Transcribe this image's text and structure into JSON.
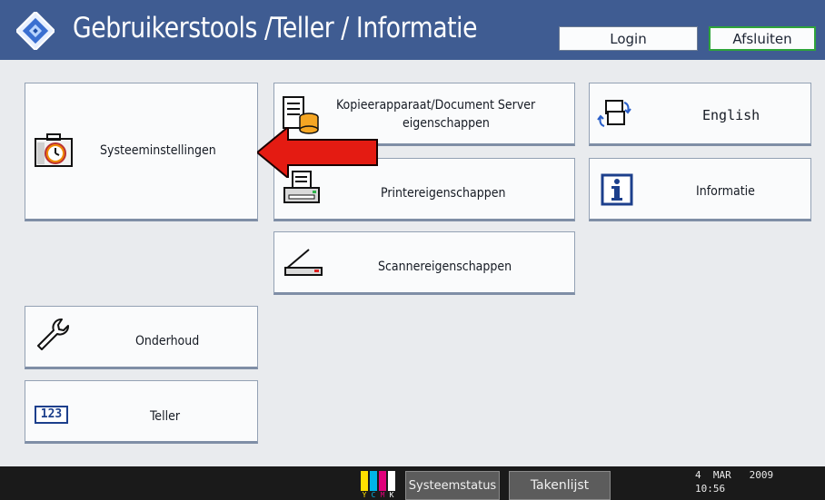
{
  "header": {
    "title": "Gebruikerstools /Teller / Informatie",
    "login_label": "Login",
    "exit_label": "Afsluiten"
  },
  "tiles": {
    "system": "Systeeminstellingen",
    "copier_line1": "Kopieerapparaat/Document Server",
    "copier_line2": "eigenschappen",
    "english": "English",
    "printer": "Printereigenschappen",
    "info": "Informatie",
    "scanner": "Scannereigenschappen",
    "maintenance": "Onderhoud",
    "counter": "Teller",
    "counter_icon_text": "123"
  },
  "footer": {
    "ink_letters": [
      "Y",
      "C",
      "M",
      "K"
    ],
    "status_label": "Systeemstatus",
    "jobs_label": "Takenlijst",
    "date": "4  MAR   2009",
    "time": "10:56"
  },
  "colors": {
    "header_bg": "#3f5c92",
    "arrow": "#e41b12",
    "exit_border": "#2ea43a",
    "footer_bg": "#1a1a1a"
  }
}
